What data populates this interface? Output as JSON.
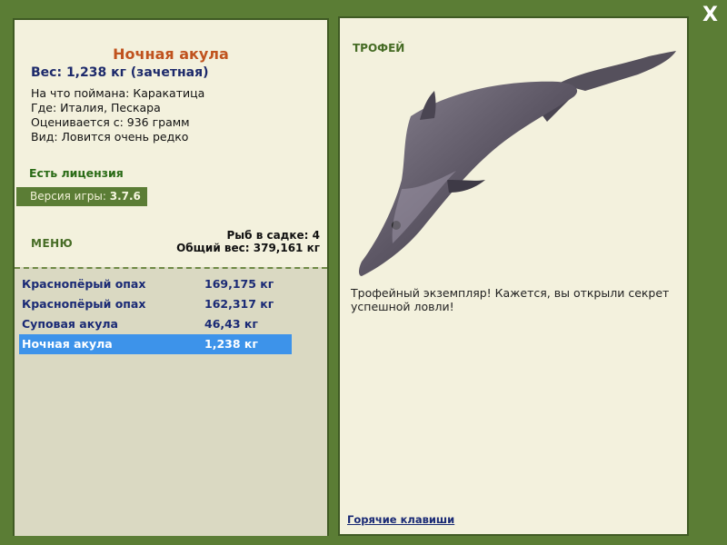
{
  "close_label": "X",
  "fish": {
    "name": "Ночная акула",
    "weight": "Вес: 1,238 кг (зачетная)",
    "bait": "На что поймана: Каракатица",
    "location": "Где: Италия, Пескара",
    "valued_from": "Оценивается с: 936 грамм",
    "rarity": "Вид: Ловится очень редко"
  },
  "license": "Есть лицензия",
  "version": {
    "label": "Версия игры:",
    "value": "3.7.6"
  },
  "menu_label": "МЕНЮ",
  "cage": {
    "count": "Рыб в садке: 4",
    "total": "Общий вес: 379,161 кг"
  },
  "catch_list": [
    {
      "name": "Краснопёрый опах",
      "weight": "169,175 кг"
    },
    {
      "name": "Краснопёрый опах",
      "weight": "162,317 кг"
    },
    {
      "name": "Суповая акула",
      "weight": "46,43 кг"
    },
    {
      "name": "Ночная акула",
      "weight": "1,238 кг"
    }
  ],
  "selected_index": 3,
  "trophy_label": "ТРОФЕЙ",
  "description": "Трофейный экземпляр! Кажется, вы открыли секрет успешной ловли!",
  "hotkeys_label": "Горячие клавиши",
  "colors": {
    "frame": "#5b7d35",
    "panel": "#f3f1dd",
    "selection": "#3d93ea",
    "title": "#c0531e"
  }
}
